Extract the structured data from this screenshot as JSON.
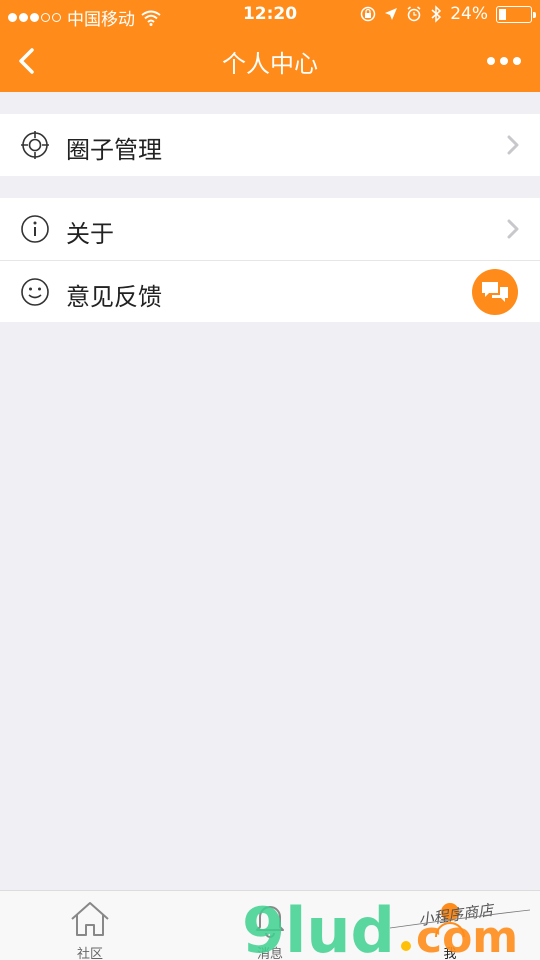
{
  "status_bar": {
    "carrier": "中国移动",
    "time": "12:20",
    "battery": "24%",
    "battery_level": 0.24
  },
  "nav": {
    "title": "个人中心"
  },
  "menu": {
    "group1": [
      {
        "label": "圈子管理",
        "icon": "target-icon"
      }
    ],
    "group2": [
      {
        "label": "关于",
        "icon": "info-icon"
      },
      {
        "label": "意见反馈",
        "icon": "smile-icon"
      }
    ]
  },
  "tabbar": {
    "tabs": [
      {
        "label": "社区",
        "icon": "home-icon"
      },
      {
        "label": "消息",
        "icon": "bell-icon"
      },
      {
        "label": "我",
        "icon": "user-icon"
      }
    ]
  },
  "watermark": {
    "text": "9lud.com",
    "subtext": "小程序商店"
  },
  "colors": {
    "accent": "#ff8c1a",
    "background": "#efeff4"
  }
}
